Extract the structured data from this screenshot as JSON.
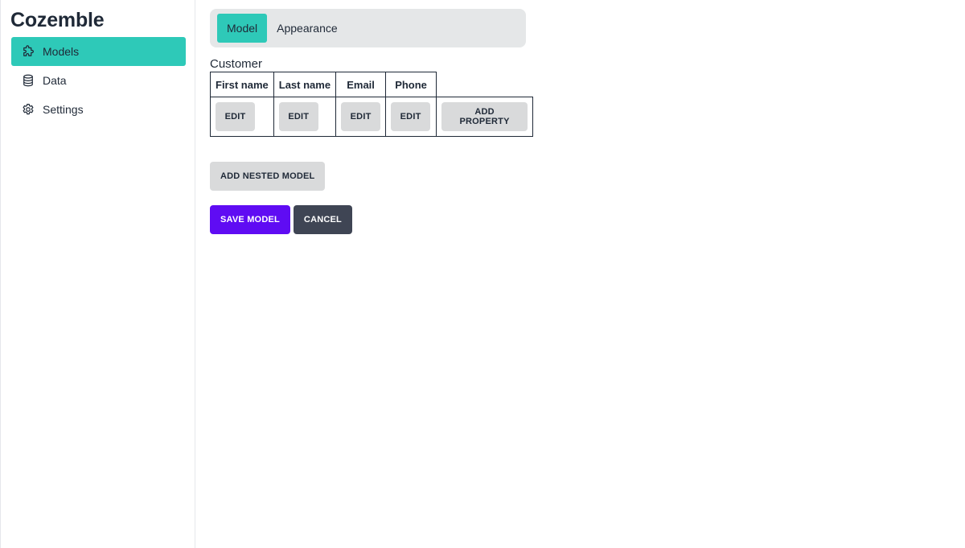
{
  "sidebar": {
    "brand": "Cozemble",
    "items": [
      {
        "label": "Models",
        "icon": "puzzle-icon",
        "active": true
      },
      {
        "label": "Data",
        "icon": "database-icon",
        "active": false
      },
      {
        "label": "Settings",
        "icon": "gear-icon",
        "active": false
      }
    ]
  },
  "tabs": [
    {
      "label": "Model",
      "active": true
    },
    {
      "label": "Appearance",
      "active": false
    }
  ],
  "model": {
    "name": "Customer",
    "columns": [
      "First name",
      "Last name",
      "Email",
      "Phone"
    ],
    "edit_label": "EDIT",
    "add_property_label": "ADD PROPERTY"
  },
  "actions": {
    "add_nested_model": "ADD NESTED MODEL",
    "save_model": "SAVE MODEL",
    "cancel": "CANCEL"
  },
  "colors": {
    "accent": "#2ec9b8",
    "primary": "#5f0cf3",
    "dark": "#3f4554",
    "light_button": "#d9dadb"
  }
}
